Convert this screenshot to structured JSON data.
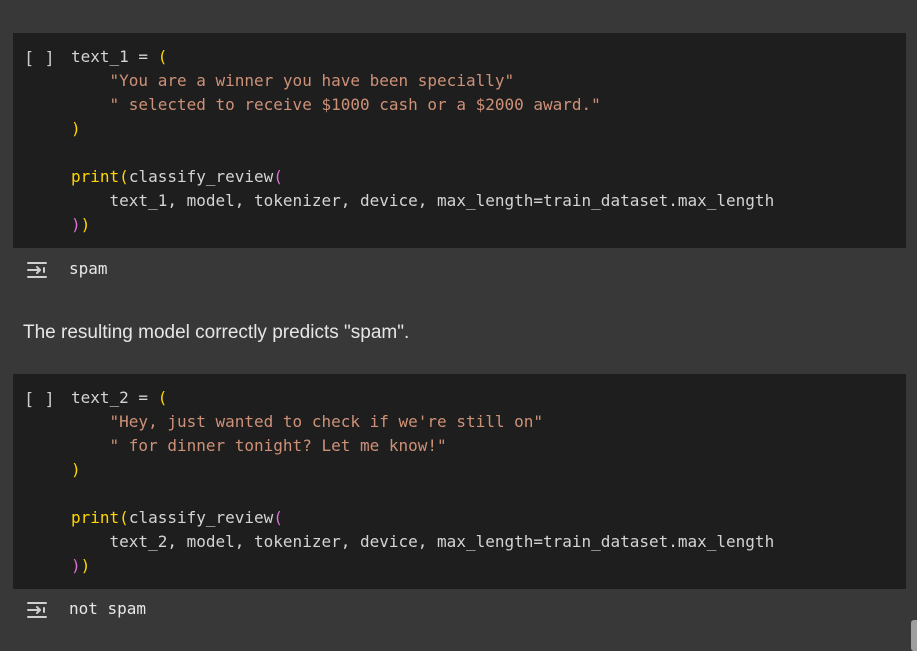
{
  "cells": [
    {
      "run_label": "[ ]",
      "code": {
        "line1_var": "text_1 = ",
        "line1_paren": "(",
        "line2": "    \"You are a winner you have been specially\"",
        "line3": "    \" selected to receive $1000 cash or a $2000 award.\"",
        "line4_paren": ")",
        "line6_fn": "print",
        "line6_p1": "(",
        "line6_call": "classify_review",
        "line6_p2": "(",
        "line7": "    text_1, model, tokenizer, device, max_length=train_dataset.max_length",
        "line8_p2": ")",
        "line8_p1": ")"
      },
      "output": "spam"
    },
    {
      "run_label": "[ ]",
      "code": {
        "line1_var": "text_2 = ",
        "line1_paren": "(",
        "line2": "    \"Hey, just wanted to check if we're still on\"",
        "line3": "    \" for dinner tonight? Let me know!\"",
        "line4_paren": ")",
        "line6_fn": "print",
        "line6_p1": "(",
        "line6_call": "classify_review",
        "line6_p2": "(",
        "line7": "    text_2, model, tokenizer, device, max_length=train_dataset.max_length",
        "line8_p2": ")",
        "line8_p1": ")"
      },
      "output": "not spam"
    }
  ],
  "text_cell": "The resulting model correctly predicts \"spam\".",
  "icons": {
    "output": "output-arrow-icon",
    "run": "run-cell-icon"
  },
  "colors": {
    "background": "#383838",
    "code_bg": "#1e1e1e",
    "string": "#ce9178",
    "paren_outer": "#ffd700",
    "paren_inner": "#da70d6"
  }
}
